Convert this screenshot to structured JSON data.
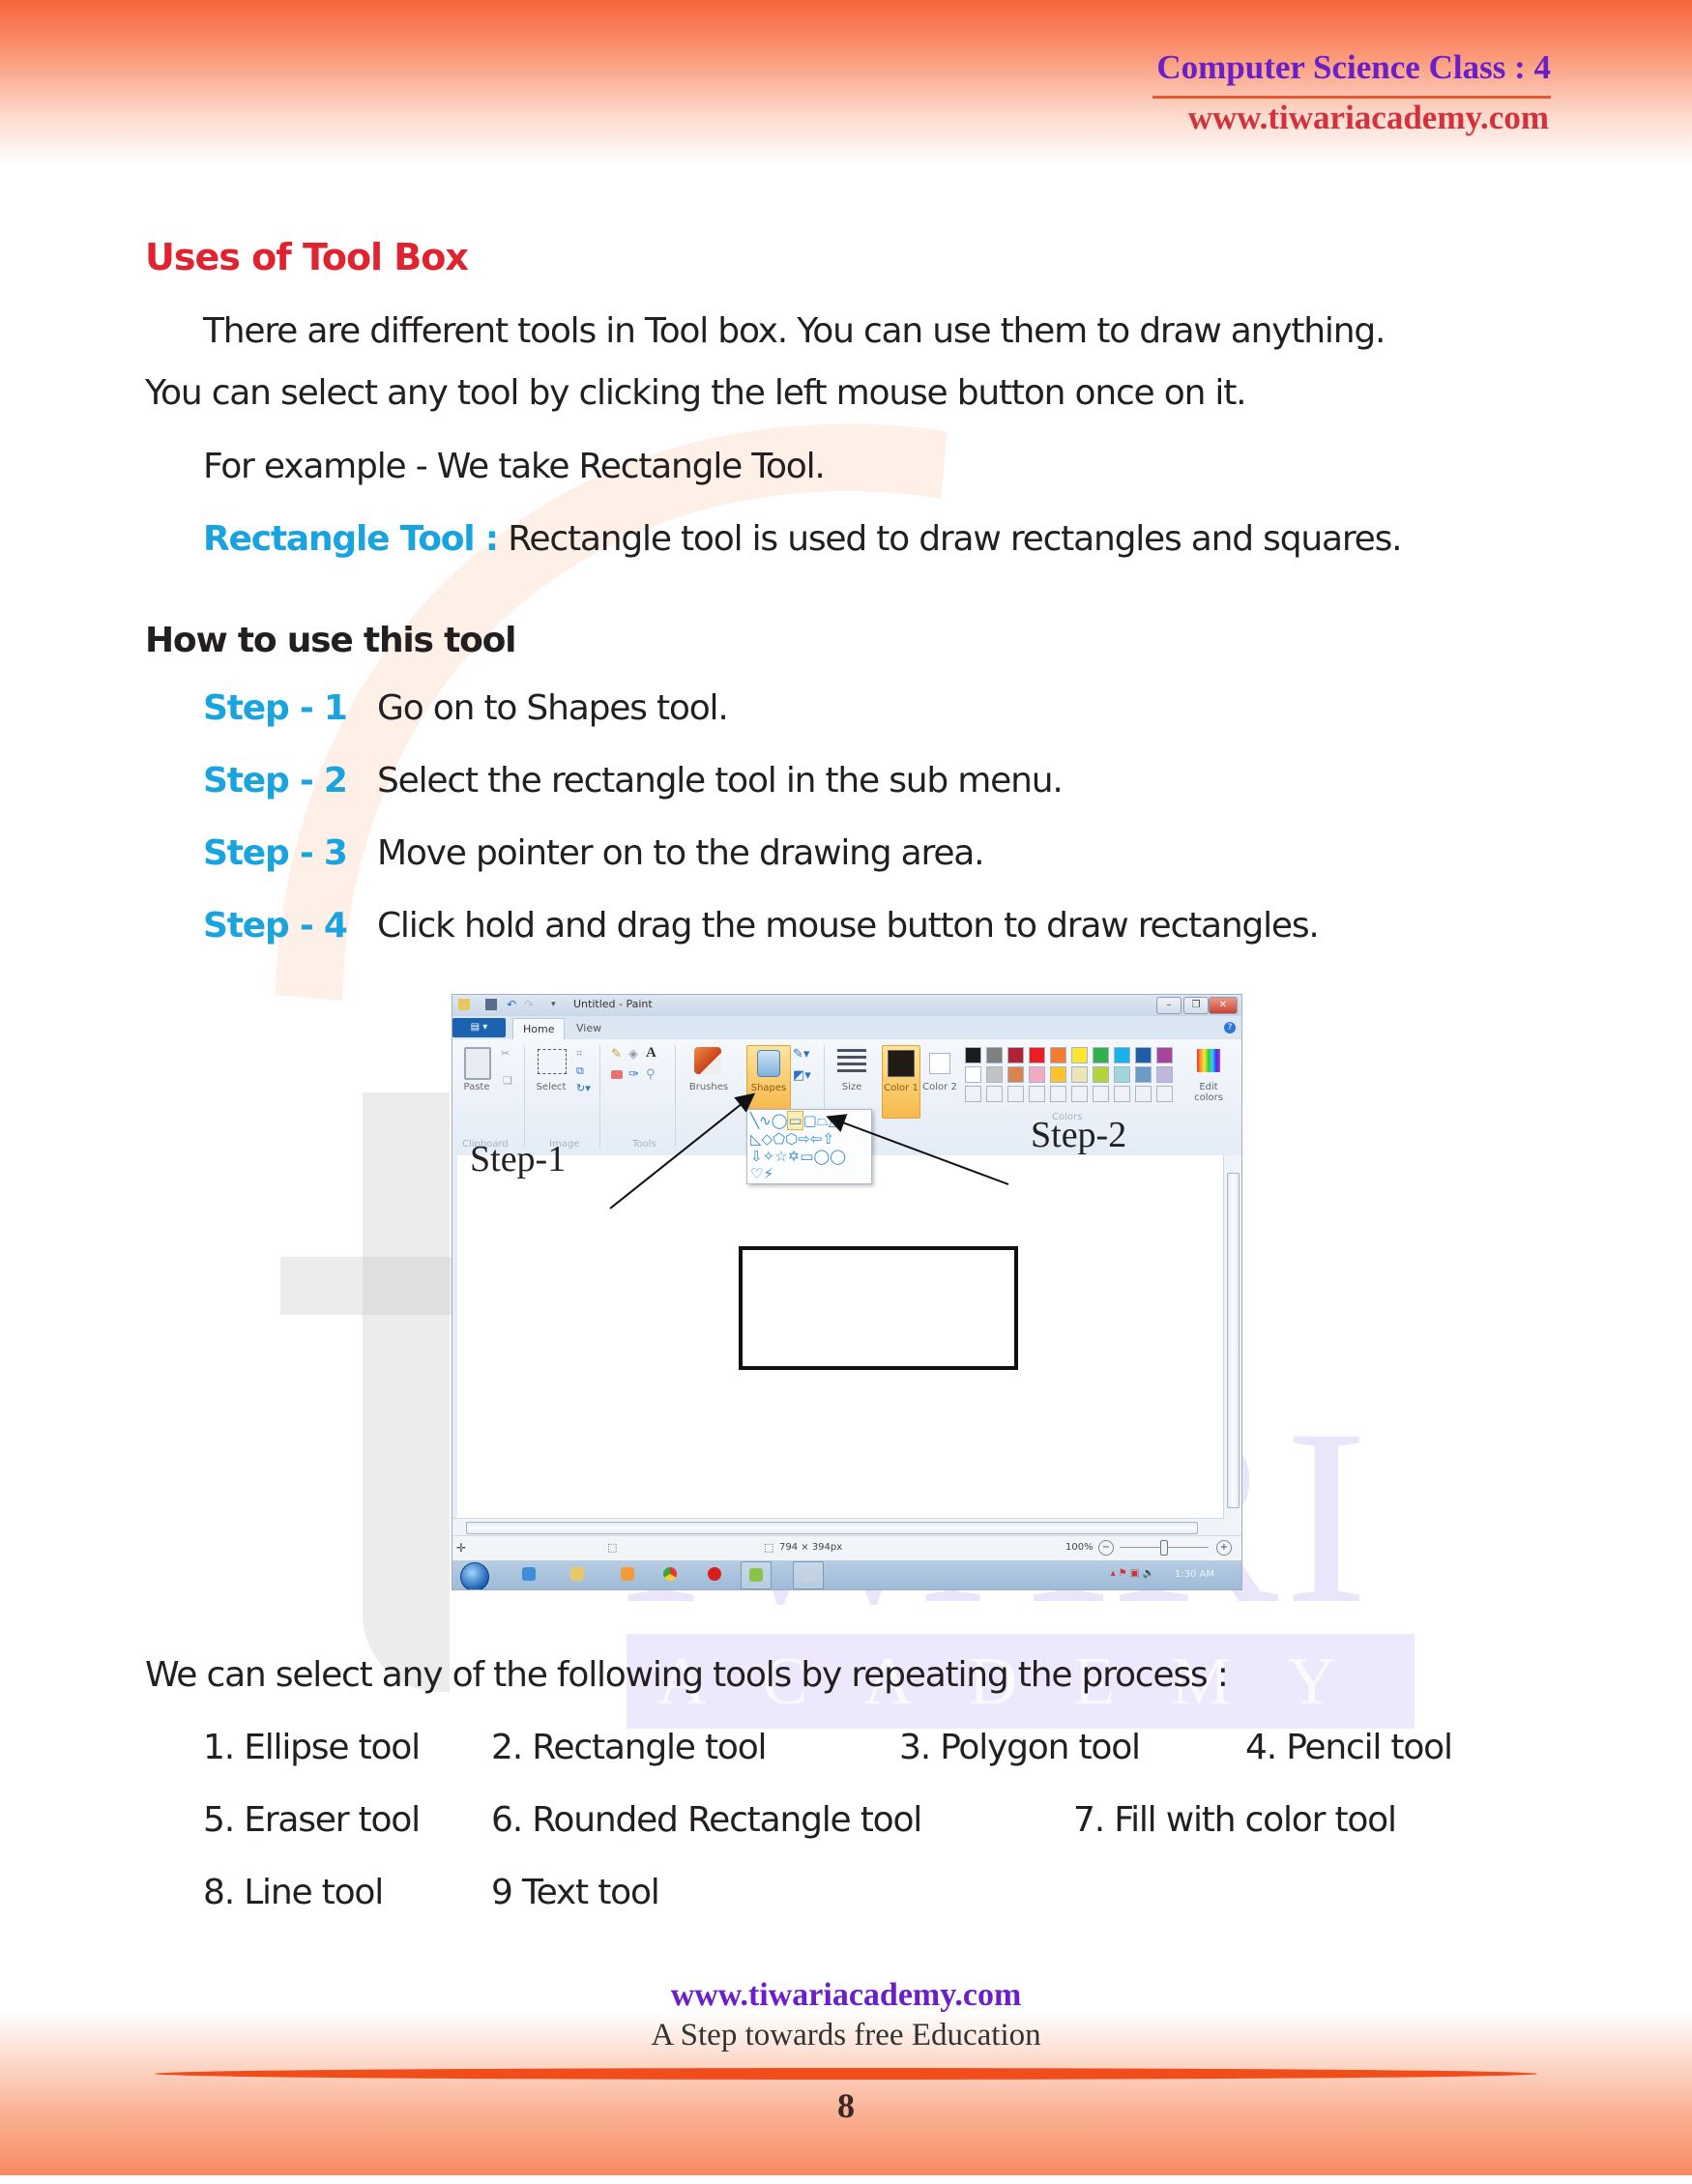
{
  "header": {
    "title": "Computer Science Class : 4",
    "url": "www.tiwariacademy.com"
  },
  "watermark": {
    "brand": "IWARI",
    "sub": "ACADEMY"
  },
  "section": {
    "heading": "Uses of Tool Box",
    "para1_line1": "There are different tools in Tool box. You can use them to draw anything.",
    "para1_line2": "You can select any tool by clicking the left mouse button once on it.",
    "example": "For example - We take Rectangle Tool.",
    "definition_label": "Rectangle Tool :",
    "definition_text": "Rectangle tool is used to draw rectangles and squares."
  },
  "how_to": {
    "heading": "How to use this tool",
    "steps": [
      {
        "label": "Step - 1",
        "text": "Go on to Shapes tool."
      },
      {
        "label": "Step - 2",
        "text": "Select the rectangle tool in the sub menu."
      },
      {
        "label": "Step - 3",
        "text": "Move pointer on to the drawing area."
      },
      {
        "label": "Step - 4",
        "text": "Click hold and drag the mouse button to draw rectangles."
      }
    ]
  },
  "paint": {
    "window_title": "Untitled - Paint",
    "tabs": [
      "Home",
      "View"
    ],
    "ribbon": {
      "paste": "Paste",
      "select": "Select",
      "brushes": "Brushes",
      "shapes": "Shapes",
      "size": "Size",
      "color1": "Color 1",
      "color2": "Color 2",
      "edit_colors": "Edit colors",
      "groups": [
        "Clipboard",
        "Image",
        "Tools",
        "Colors"
      ]
    },
    "palette_row1": [
      "#1c1c1c",
      "#7f7f7f",
      "#b22234",
      "#ed1c24",
      "#f47a30",
      "#fde62f",
      "#34b04a",
      "#15b3e8",
      "#1f5fa8",
      "#a8449c"
    ],
    "palette_row2": [
      "#ffffff",
      "#c3c3c3",
      "#d9834f",
      "#f2a9c4",
      "#fbc32d",
      "#efe5b4",
      "#b5d33a",
      "#9fd6e0",
      "#6b9bc6",
      "#c0b8dc"
    ],
    "shapes_rows": [
      "╲∿◯▭▢⏢△",
      "◺◇⬠⬡⇨⇦⇧",
      "⇩✧☆✡▭◯◯",
      "♡⚡"
    ],
    "canvas_size": "794 × 394px",
    "zoom": "100%",
    "clock": "1:30 AM",
    "annotations": {
      "step1": "Step-1",
      "step2": "Step-2"
    }
  },
  "tools_intro": "We can select any of the following tools by repeating the process :",
  "tools": [
    "1.  Ellipse tool",
    "2.  Rectangle tool",
    "3.  Polygon tool",
    "4.  Pencil tool",
    "5.  Eraser tool",
    "6.  Rounded Rectangle tool",
    "7.  Fill with color tool",
    "8.  Line tool",
    "9   Text tool"
  ],
  "footer": {
    "url": "www.tiwariacademy.com",
    "tagline": "A Step towards free Education",
    "page_number": "8"
  }
}
